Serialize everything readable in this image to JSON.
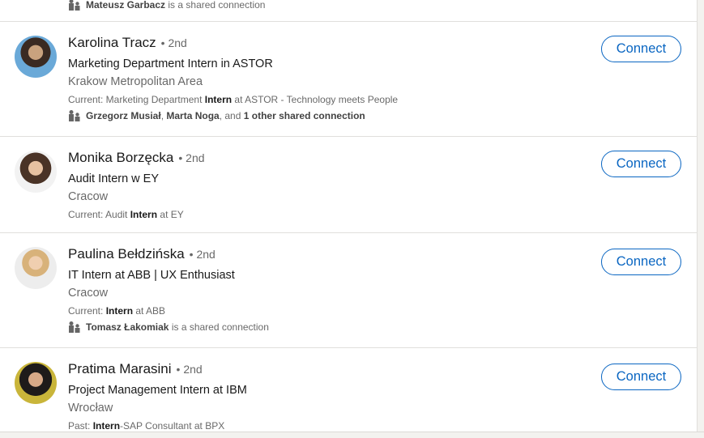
{
  "colors": {
    "accent": "#0a66c2",
    "divider": "#e0dfdc"
  },
  "partial_item": {
    "shared_strong": "Mateusz Garbacz",
    "shared_text": " is a shared connection"
  },
  "people": [
    {
      "name": "Karolina Tracz",
      "degree": "• 2nd",
      "headline": "Marketing Department Intern in ASTOR",
      "location": "Krakow Metropolitan Area",
      "current_prefix": "Current: Marketing Department ",
      "current_strong": "Intern",
      "current_suffix": " at ASTOR - Technology meets People",
      "shared_strong_1": "Grzegorz Musiał",
      "shared_sep": ", ",
      "shared_strong_2": "Marta Noga",
      "shared_mid": ", and ",
      "shared_strong_3": "1 other shared connection",
      "connect_label": "Connect"
    },
    {
      "name": "Monika Borzęcka",
      "degree": "• 2nd",
      "headline": "Audit Intern w EY",
      "location": "Cracow",
      "current_prefix": "Current: Audit ",
      "current_strong": "Intern",
      "current_suffix": " at EY",
      "connect_label": "Connect"
    },
    {
      "name": "Paulina Bełdzińska",
      "degree": "• 2nd",
      "headline": "IT Intern at ABB | UX Enthusiast",
      "location": "Cracow",
      "current_prefix": "Current: ",
      "current_strong": "Intern",
      "current_suffix": " at ABB",
      "shared_strong_1": "Tomasz Łakomiak",
      "shared_text": " is a shared connection",
      "connect_label": "Connect"
    },
    {
      "name": "Pratima Marasini",
      "degree": "• 2nd",
      "headline": "Project Management Intern at IBM",
      "location": "Wrocław",
      "current_prefix": "Past: ",
      "current_strong": "Intern",
      "current_suffix": "-SAP Consultant at BPX",
      "connect_label": "Connect"
    }
  ]
}
